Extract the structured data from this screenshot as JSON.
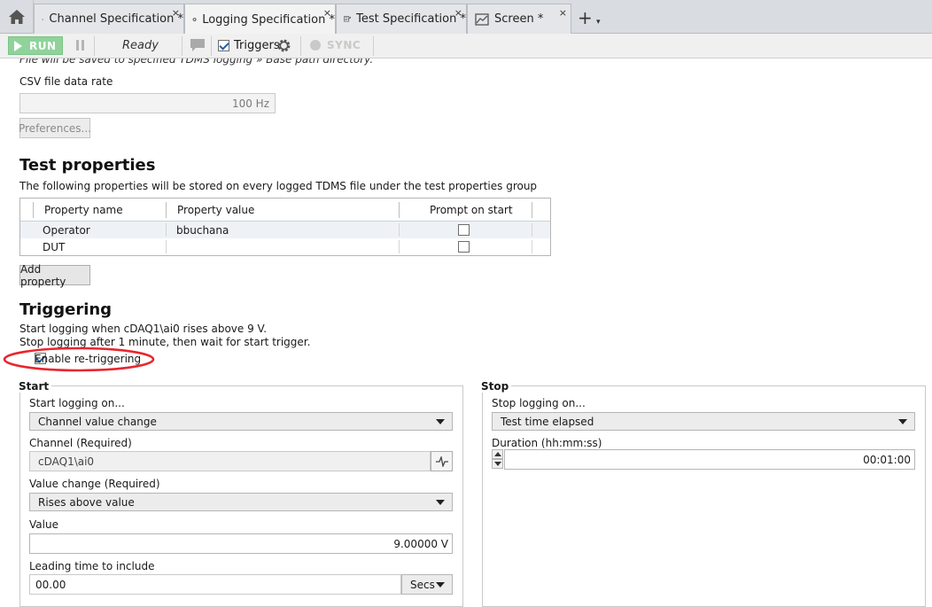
{
  "tabs": [
    {
      "label": "Channel Specification *",
      "close": "×",
      "icon": "channel-icon"
    },
    {
      "label": "Logging Specification *",
      "close": "×",
      "icon": "gear-icon"
    },
    {
      "label": "Test Specification *",
      "close": "×",
      "icon": "test-icon"
    },
    {
      "label": "Screen *",
      "close": "×",
      "icon": "screen-icon"
    }
  ],
  "tabbar": {
    "add": "+",
    "overflow": "▾"
  },
  "toolbar": {
    "run_label": "RUN",
    "status": "Ready",
    "triggers_label": "Triggers",
    "triggers_checked": true,
    "sync_label": "SYNC"
  },
  "logging": {
    "cut_text": "File will be saved to specified TDMS logging » Base path directory.",
    "csv_rate_label": "CSV file data rate",
    "csv_rate_value": "100 Hz",
    "preferences_button": "Preferences..."
  },
  "test_properties": {
    "heading": "Test properties",
    "description": "The following properties will be stored on every logged TDMS file under the test properties group",
    "columns": [
      "Property name",
      "Property value",
      "Prompt on start"
    ],
    "rows": [
      {
        "name": "Operator",
        "value": "bbuchana",
        "prompt": false
      },
      {
        "name": "DUT",
        "value": "",
        "prompt": false
      }
    ],
    "add_button": "Add property"
  },
  "triggering": {
    "heading": "Triggering",
    "summary_1": "Start logging when cDAQ1\\ai0 rises above 9 V.",
    "summary_2": "Stop logging after 1 minute, then wait for start trigger.",
    "retrigger_label": "Enable re-triggering",
    "retrigger_checked": true,
    "annotation_color": "#e8262d"
  },
  "start": {
    "group_label": "Start",
    "mode_label": "Start logging on...",
    "mode_value": "Channel value change",
    "channel_label": "Channel (Required)",
    "channel_value": "cDAQ1\\ai0",
    "value_change_label": "Value change (Required)",
    "value_change_value": "Rises above value",
    "value_label": "Value",
    "value_value": "9.00000 V",
    "leading_label": "Leading time to include",
    "leading_value": "00.00",
    "leading_unit": "Secs"
  },
  "stop": {
    "group_label": "Stop",
    "mode_label": "Stop logging on...",
    "mode_value": "Test time elapsed",
    "duration_label": "Duration (hh:mm:ss)",
    "duration_value": "00:01:00"
  }
}
